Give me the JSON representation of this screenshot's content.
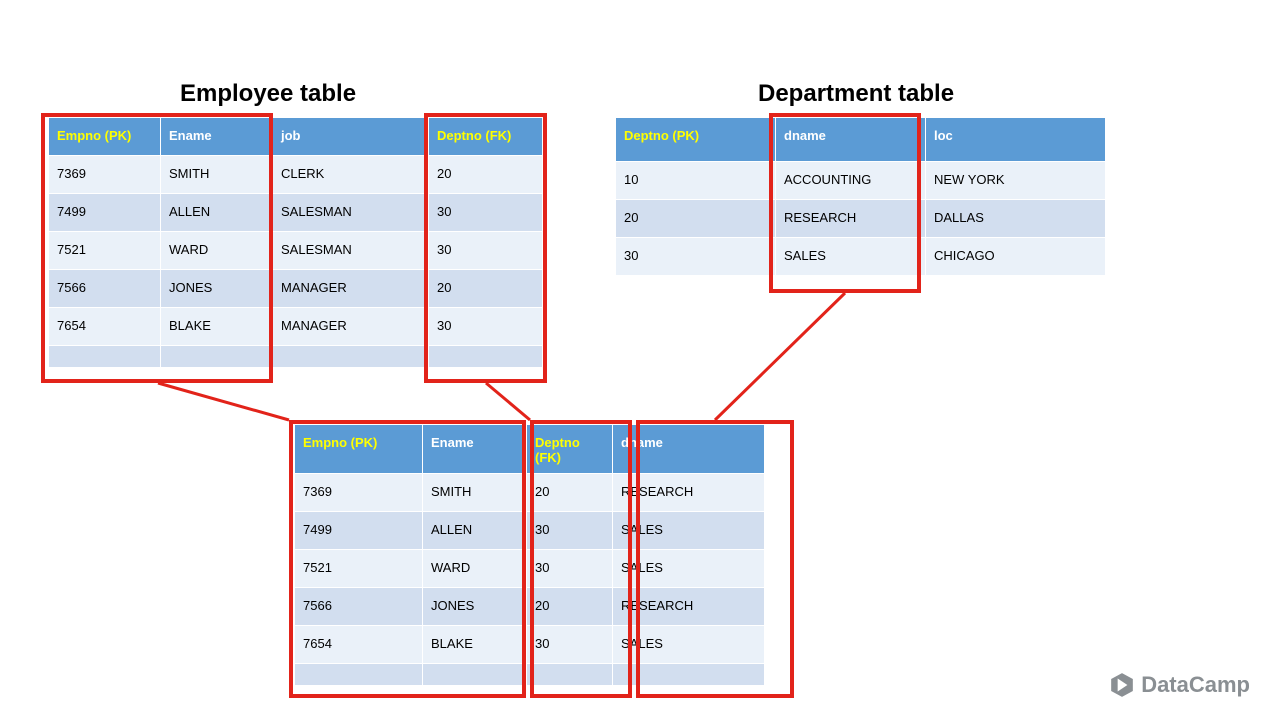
{
  "titles": {
    "employee": "Employee table",
    "department": "Department table"
  },
  "employee": {
    "headers": [
      "Empno (PK)",
      "Ename",
      "job",
      "Deptno (FK)"
    ],
    "hl": [
      true,
      false,
      false,
      true
    ],
    "widths": [
      112,
      112,
      156,
      114
    ],
    "rows": [
      [
        "7369",
        "SMITH",
        "CLERK",
        "20"
      ],
      [
        "7499",
        "ALLEN",
        "SALESMAN",
        "30"
      ],
      [
        "7521",
        "WARD",
        "SALESMAN",
        "30"
      ],
      [
        "7566",
        "JONES",
        "MANAGER",
        "20"
      ],
      [
        "7654",
        "BLAKE",
        "MANAGER",
        "30"
      ]
    ],
    "blankRow": true
  },
  "department": {
    "headers": [
      "Deptno (PK)",
      "dname",
      "loc"
    ],
    "hl": [
      true,
      false,
      false
    ],
    "widths": [
      160,
      150,
      180
    ],
    "rows": [
      [
        "10",
        "ACCOUNTING",
        "NEW YORK"
      ],
      [
        "20",
        "RESEARCH",
        "DALLAS"
      ],
      [
        "30",
        "SALES",
        "CHICAGO"
      ]
    ],
    "blankRow": false,
    "headerHeight": 44
  },
  "joined": {
    "headers": [
      "Empno (PK)",
      "Ename",
      "Deptno (FK)",
      "dname"
    ],
    "hl": [
      true,
      false,
      true,
      false
    ],
    "widths": [
      128,
      104,
      86,
      152
    ],
    "rows": [
      [
        "7369",
        "SMITH",
        "20",
        "RESEARCH"
      ],
      [
        "7499",
        "ALLEN",
        "30",
        "SALES"
      ],
      [
        "7521",
        "WARD",
        "30",
        "SALES"
      ],
      [
        "7566",
        "JONES",
        "20",
        "RESEARCH"
      ],
      [
        "7654",
        "BLAKE",
        "30",
        "SALES"
      ]
    ],
    "blankRow": true,
    "headerHeight": 44
  },
  "logo": "DataCamp",
  "chart_data": {
    "type": "table",
    "description": "SQL JOIN diagram: Employee table joined to Department table on Deptno",
    "employee_table": {
      "columns": [
        "Empno (PK)",
        "Ename",
        "job",
        "Deptno (FK)"
      ],
      "rows": [
        [
          7369,
          "SMITH",
          "CLERK",
          20
        ],
        [
          7499,
          "ALLEN",
          "SALESMAN",
          30
        ],
        [
          7521,
          "WARD",
          "SALESMAN",
          30
        ],
        [
          7566,
          "JONES",
          "MANAGER",
          20
        ],
        [
          7654,
          "BLAKE",
          "MANAGER",
          30
        ]
      ]
    },
    "department_table": {
      "columns": [
        "Deptno (PK)",
        "dname",
        "loc"
      ],
      "rows": [
        [
          10,
          "ACCOUNTING",
          "NEW YORK"
        ],
        [
          20,
          "RESEARCH",
          "DALLAS"
        ],
        [
          30,
          "SALES",
          "CHICAGO"
        ]
      ]
    },
    "joined_result": {
      "columns": [
        "Empno (PK)",
        "Ename",
        "Deptno (FK)",
        "dname"
      ],
      "rows": [
        [
          7369,
          "SMITH",
          20,
          "RESEARCH"
        ],
        [
          7499,
          "ALLEN",
          30,
          "SALES"
        ],
        [
          7521,
          "WARD",
          30,
          "SALES"
        ],
        [
          7566,
          "JONES",
          20,
          "RESEARCH"
        ],
        [
          7654,
          "BLAKE",
          30,
          "SALES"
        ]
      ]
    },
    "join_key": "Deptno",
    "highlighted_columns": {
      "employee": [
        "Empno (PK)",
        "Ename",
        "Deptno (FK)"
      ],
      "department": [
        "dname"
      ],
      "joined": [
        "Empno (PK)",
        "Ename",
        "Deptno (FK)",
        "dname"
      ]
    }
  }
}
